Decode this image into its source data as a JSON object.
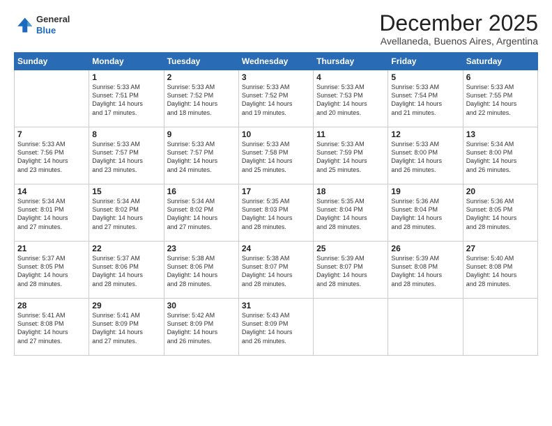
{
  "logo": {
    "general": "General",
    "blue": "Blue"
  },
  "header": {
    "month": "December 2025",
    "location": "Avellaneda, Buenos Aires, Argentina"
  },
  "days_of_week": [
    "Sunday",
    "Monday",
    "Tuesday",
    "Wednesday",
    "Thursday",
    "Friday",
    "Saturday"
  ],
  "weeks": [
    [
      {
        "day": "",
        "info": ""
      },
      {
        "day": "1",
        "info": "Sunrise: 5:33 AM\nSunset: 7:51 PM\nDaylight: 14 hours\nand 17 minutes."
      },
      {
        "day": "2",
        "info": "Sunrise: 5:33 AM\nSunset: 7:52 PM\nDaylight: 14 hours\nand 18 minutes."
      },
      {
        "day": "3",
        "info": "Sunrise: 5:33 AM\nSunset: 7:52 PM\nDaylight: 14 hours\nand 19 minutes."
      },
      {
        "day": "4",
        "info": "Sunrise: 5:33 AM\nSunset: 7:53 PM\nDaylight: 14 hours\nand 20 minutes."
      },
      {
        "day": "5",
        "info": "Sunrise: 5:33 AM\nSunset: 7:54 PM\nDaylight: 14 hours\nand 21 minutes."
      },
      {
        "day": "6",
        "info": "Sunrise: 5:33 AM\nSunset: 7:55 PM\nDaylight: 14 hours\nand 22 minutes."
      }
    ],
    [
      {
        "day": "7",
        "info": "Sunrise: 5:33 AM\nSunset: 7:56 PM\nDaylight: 14 hours\nand 23 minutes."
      },
      {
        "day": "8",
        "info": "Sunrise: 5:33 AM\nSunset: 7:57 PM\nDaylight: 14 hours\nand 23 minutes."
      },
      {
        "day": "9",
        "info": "Sunrise: 5:33 AM\nSunset: 7:57 PM\nDaylight: 14 hours\nand 24 minutes."
      },
      {
        "day": "10",
        "info": "Sunrise: 5:33 AM\nSunset: 7:58 PM\nDaylight: 14 hours\nand 25 minutes."
      },
      {
        "day": "11",
        "info": "Sunrise: 5:33 AM\nSunset: 7:59 PM\nDaylight: 14 hours\nand 25 minutes."
      },
      {
        "day": "12",
        "info": "Sunrise: 5:33 AM\nSunset: 8:00 PM\nDaylight: 14 hours\nand 26 minutes."
      },
      {
        "day": "13",
        "info": "Sunrise: 5:34 AM\nSunset: 8:00 PM\nDaylight: 14 hours\nand 26 minutes."
      }
    ],
    [
      {
        "day": "14",
        "info": "Sunrise: 5:34 AM\nSunset: 8:01 PM\nDaylight: 14 hours\nand 27 minutes."
      },
      {
        "day": "15",
        "info": "Sunrise: 5:34 AM\nSunset: 8:02 PM\nDaylight: 14 hours\nand 27 minutes."
      },
      {
        "day": "16",
        "info": "Sunrise: 5:34 AM\nSunset: 8:02 PM\nDaylight: 14 hours\nand 27 minutes."
      },
      {
        "day": "17",
        "info": "Sunrise: 5:35 AM\nSunset: 8:03 PM\nDaylight: 14 hours\nand 28 minutes."
      },
      {
        "day": "18",
        "info": "Sunrise: 5:35 AM\nSunset: 8:04 PM\nDaylight: 14 hours\nand 28 minutes."
      },
      {
        "day": "19",
        "info": "Sunrise: 5:36 AM\nSunset: 8:04 PM\nDaylight: 14 hours\nand 28 minutes."
      },
      {
        "day": "20",
        "info": "Sunrise: 5:36 AM\nSunset: 8:05 PM\nDaylight: 14 hours\nand 28 minutes."
      }
    ],
    [
      {
        "day": "21",
        "info": "Sunrise: 5:37 AM\nSunset: 8:05 PM\nDaylight: 14 hours\nand 28 minutes."
      },
      {
        "day": "22",
        "info": "Sunrise: 5:37 AM\nSunset: 8:06 PM\nDaylight: 14 hours\nand 28 minutes."
      },
      {
        "day": "23",
        "info": "Sunrise: 5:38 AM\nSunset: 8:06 PM\nDaylight: 14 hours\nand 28 minutes."
      },
      {
        "day": "24",
        "info": "Sunrise: 5:38 AM\nSunset: 8:07 PM\nDaylight: 14 hours\nand 28 minutes."
      },
      {
        "day": "25",
        "info": "Sunrise: 5:39 AM\nSunset: 8:07 PM\nDaylight: 14 hours\nand 28 minutes."
      },
      {
        "day": "26",
        "info": "Sunrise: 5:39 AM\nSunset: 8:08 PM\nDaylight: 14 hours\nand 28 minutes."
      },
      {
        "day": "27",
        "info": "Sunrise: 5:40 AM\nSunset: 8:08 PM\nDaylight: 14 hours\nand 28 minutes."
      }
    ],
    [
      {
        "day": "28",
        "info": "Sunrise: 5:41 AM\nSunset: 8:08 PM\nDaylight: 14 hours\nand 27 minutes."
      },
      {
        "day": "29",
        "info": "Sunrise: 5:41 AM\nSunset: 8:09 PM\nDaylight: 14 hours\nand 27 minutes."
      },
      {
        "day": "30",
        "info": "Sunrise: 5:42 AM\nSunset: 8:09 PM\nDaylight: 14 hours\nand 26 minutes."
      },
      {
        "day": "31",
        "info": "Sunrise: 5:43 AM\nSunset: 8:09 PM\nDaylight: 14 hours\nand 26 minutes."
      },
      {
        "day": "",
        "info": ""
      },
      {
        "day": "",
        "info": ""
      },
      {
        "day": "",
        "info": ""
      }
    ]
  ]
}
